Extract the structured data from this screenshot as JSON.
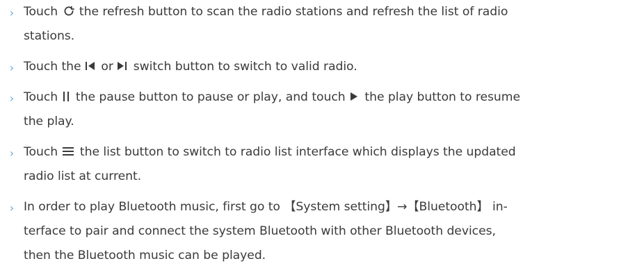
{
  "doc": {
    "items": [
      {
        "bullet": "›",
        "parts": [
          "Touch",
          "the refresh button to scan the radio stations and refresh the list of radio",
          "stations."
        ],
        "icons": [
          "refresh-icon"
        ]
      },
      {
        "bullet": "›",
        "parts": [
          "Touch the",
          "or",
          "switch button to switch to valid radio."
        ],
        "icons": [
          "previous-track-icon",
          "next-track-icon"
        ]
      },
      {
        "bullet": "›",
        "parts": [
          "Touch",
          "the pause button to pause or play, and touch",
          "the play button to resume",
          "the play."
        ],
        "icons": [
          "pause-icon",
          "play-icon"
        ]
      },
      {
        "bullet": "›",
        "parts": [
          "Touch",
          "the list button to switch to radio list interface which displays the updated",
          "radio list at current."
        ],
        "icons": [
          "list-icon"
        ]
      },
      {
        "bullet": "›",
        "parts": [
          "In order to play Bluetooth music, first go to 【System setting】→【Bluetooth】 in-",
          "terface to pair and connect the system Bluetooth with other Bluetooth devices,",
          "then the Bluetooth music can be played."
        ],
        "icons": []
      }
    ]
  }
}
